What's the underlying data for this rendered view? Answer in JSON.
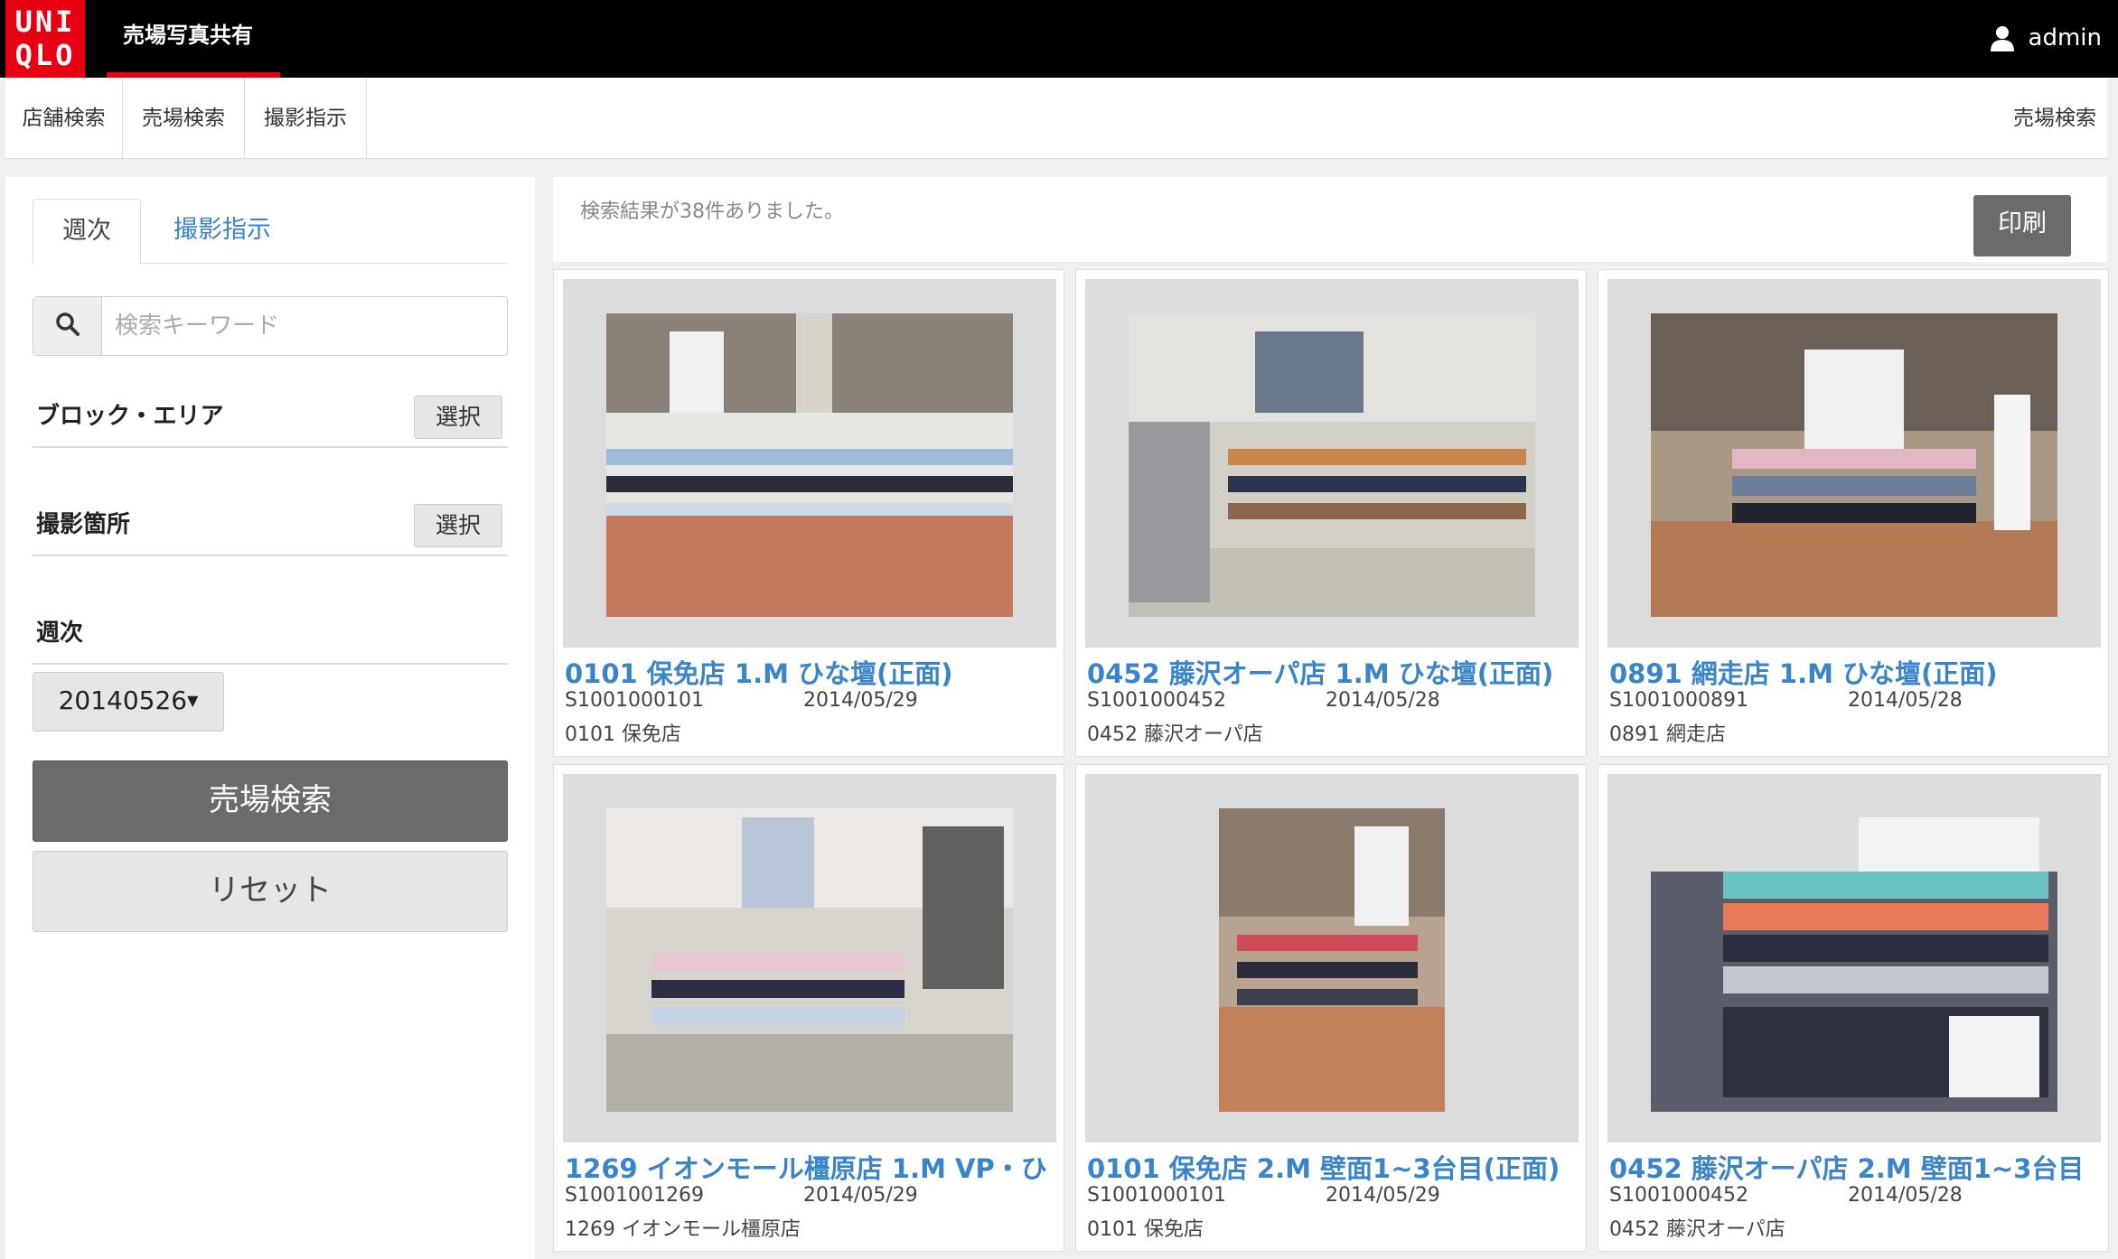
{
  "header": {
    "logo_line1": "UNI",
    "logo_line2": "QLO",
    "app_title": "売場写真共有",
    "user_name": "admin"
  },
  "nav": {
    "items": [
      "店舗検索",
      "売場検索",
      "撮影指示"
    ],
    "right_label": "売場検索"
  },
  "sidebar": {
    "tabs": [
      {
        "label": "週次",
        "active": true
      },
      {
        "label": "撮影指示",
        "active": false
      }
    ],
    "search_placeholder": "検索キーワード",
    "filters": [
      {
        "label": "ブロック・エリア",
        "button": "選択"
      },
      {
        "label": "撮影箇所",
        "button": "選択"
      }
    ],
    "week_label": "週次",
    "week_value": "20140526",
    "search_button": "売場検索",
    "reset_button": "リセット"
  },
  "results": {
    "summary": "検索結果が38件ありました。",
    "print_button": "印刷",
    "items": [
      {
        "title": "0101 保免店 1.M ひな壇(正面)",
        "code": "S1001000101",
        "date": "2014/05/29",
        "store": "0101 保免店"
      },
      {
        "title": "0452 藤沢オーパ店 1.M ひな壇(正面)",
        "code": "S1001000452",
        "date": "2014/05/28",
        "store": "0452 藤沢オーパ店"
      },
      {
        "title": "0891 網走店 1.M ひな壇(正面)",
        "code": "S1001000891",
        "date": "2014/05/28",
        "store": "0891 網走店"
      },
      {
        "title": "1269 イオンモール橿原店 1.M VP・ひ",
        "code": "S1001001269",
        "date": "2014/05/29",
        "store": "1269 イオンモール橿原店"
      },
      {
        "title": "0101 保免店 2.M 壁面1~3台目(正面)",
        "code": "S1001000101",
        "date": "2014/05/29",
        "store": "0101 保免店"
      },
      {
        "title": "0452 藤沢オーパ店 2.M 壁面1~3台目",
        "code": "S1001000452",
        "date": "2014/05/28",
        "store": "0452 藤沢オーパ店"
      }
    ]
  },
  "colors": {
    "brand_red": "#e60012",
    "link_blue": "#3a84c9",
    "dark_button": "#6b6b6b"
  },
  "icons": {
    "user": "user-icon",
    "search": "search-icon",
    "caret": "caret-down-icon"
  }
}
